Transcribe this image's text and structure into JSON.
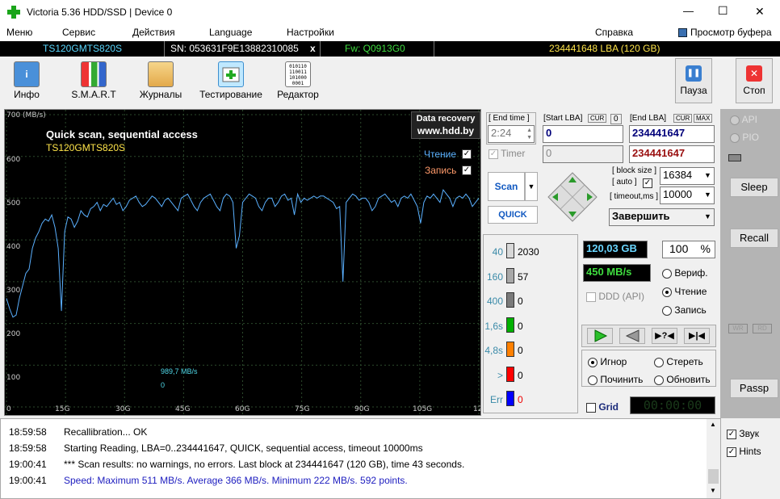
{
  "window": {
    "title": "Victoria 5.36 HDD/SSD | Device 0",
    "minimize": "—",
    "maximize": "☐",
    "close": "✕"
  },
  "menu": {
    "items": [
      "Меню",
      "Сервис",
      "Действия",
      "Language",
      "Настройки"
    ],
    "help": "Справка",
    "buffer": "Просмотр буфера"
  },
  "info": {
    "model": "TS120GMTS820S",
    "sn": "SN: 053631F9E13882310085",
    "x": "x",
    "fw": "Fw: Q0913G0",
    "lba": "234441648 LBA (120 GB)"
  },
  "toolbar": {
    "info": "Инфо",
    "smart": "S.M.A.R.T",
    "logs": "Журналы",
    "test": "Тестирование",
    "editor": "Редактор",
    "pause": "Пауза",
    "stop": "Стоп"
  },
  "graph": {
    "title": "Quick scan, sequential access",
    "model": "TS120GMTS820S",
    "recovery1": "Data recovery",
    "recovery2": "www.hdd.by",
    "read": "Чтение",
    "write": "Запись",
    "max_label": "989,7 MB/s",
    "zero": "0",
    "y_unit": "700 (MB/s)",
    "yticks": [
      "600",
      "500",
      "400",
      "300",
      "200",
      "100"
    ],
    "xticks": [
      "0",
      "15G",
      "30G",
      "45G",
      "60G",
      "75G",
      "90G",
      "105G",
      "12"
    ]
  },
  "chart_data": {
    "type": "line",
    "title": "Quick scan, sequential access",
    "xlabel": "",
    "ylabel": "MB/s",
    "ylim": [
      0,
      700
    ],
    "x_range_gb": [
      0,
      120
    ],
    "series": [
      {
        "name": "Чтение",
        "values": [
          260,
          235,
          215,
          220,
          260,
          290,
          320,
          330,
          380,
          405,
          420,
          440,
          450,
          445,
          460,
          430,
          380,
          230,
          420,
          455,
          450,
          430,
          445,
          470,
          460,
          455,
          475,
          480,
          490,
          470,
          485,
          480,
          490,
          500,
          485,
          490,
          470,
          480,
          495,
          500,
          505,
          490,
          480,
          485,
          495,
          505,
          500,
          490,
          480,
          495,
          500,
          490,
          480,
          470,
          500,
          505,
          510,
          495,
          480,
          470,
          490,
          500,
          505,
          510,
          495,
          480,
          470,
          500,
          510,
          505,
          490,
          380,
          410,
          490,
          500,
          510,
          505,
          500,
          480,
          470,
          490,
          500,
          500,
          480,
          490,
          505,
          510,
          495,
          500,
          460,
          510,
          490,
          500,
          495,
          500,
          505,
          500,
          505,
          505,
          500,
          495,
          490,
          475,
          480,
          300,
          490,
          500,
          510,
          505,
          495,
          500,
          500,
          490,
          470,
          480,
          500,
          505,
          510,
          500,
          490,
          495,
          480,
          500,
          505,
          500,
          510,
          495,
          480,
          440,
          490,
          505,
          500,
          510,
          500,
          490,
          520,
          510,
          500,
          480,
          500,
          505,
          500,
          510,
          500,
          480,
          490,
          500
        ]
      }
    ]
  },
  "test": {
    "end_time_label": "[ End time ]",
    "start_lba_label": "[Start LBA]",
    "cur": "CUR",
    "cur_val": "0",
    "end_lba_label": "[End LBA]",
    "max": "MAX",
    "time": "2:24",
    "start_lba": "0",
    "end_lba": "234441647",
    "timer_label": "Timer",
    "timer_val": "0",
    "end_lba2": "234441647",
    "scan": "Scan",
    "quick": "QUICK",
    "block_size_label": "[ block size ]",
    "auto_label": "[ auto ]",
    "timeout_label": "[ timeout,ms ]",
    "block_size": "16384",
    "timeout": "10000",
    "finish": "Завершить"
  },
  "stats": {
    "rows": [
      {
        "label": "40",
        "count": "2030",
        "color": "#d8d8d8"
      },
      {
        "label": "160",
        "count": "57",
        "color": "#a8a8a8"
      },
      {
        "label": "400",
        "count": "0",
        "color": "#7a7a7a"
      },
      {
        "label": "1,6s",
        "count": "0",
        "color": "#00b000"
      },
      {
        "label": "4,8s",
        "count": "0",
        "color": "#ff8000"
      },
      {
        "label": ">",
        "count": "0",
        "color": "#ff0000"
      },
      {
        "label": "Err",
        "count": "0",
        "color": "#0000ff"
      }
    ]
  },
  "metrics": {
    "gb": "120,03 GB",
    "percent": "100",
    "pct_sign": "%",
    "speed": "450 MB/s",
    "verify": "Вериф.",
    "read": "Чтение",
    "write": "Запись",
    "ddd": "DDD (API)",
    "ignore": "Игнор",
    "erase": "Стереть",
    "repair": "Починить",
    "refresh": "Обновить",
    "grid": "Grid",
    "clock": "00:00:00"
  },
  "side": {
    "api": "API",
    "pio": "PIO",
    "sleep": "Sleep",
    "recall": "Recall",
    "wr": "WR",
    "rd": "RD",
    "passp": "Passp",
    "sound": "Звук",
    "hints": "Hints"
  },
  "log": [
    {
      "time": "18:59:58",
      "text": "Recallibration... OK",
      "color": "#000"
    },
    {
      "time": "18:59:58",
      "text": "Starting Reading, LBA=0..234441647, QUICK, sequential access, timeout 10000ms",
      "color": "#000"
    },
    {
      "time": "19:00:41",
      "text": "*** Scan results: no warnings, no errors. Last block at 234441647 (120 GB), time 43 seconds.",
      "color": "#000"
    },
    {
      "time": "19:00:41",
      "text": "Speed: Maximum 511 MB/s. Average 366 MB/s. Minimum 222 MB/s. 592 points.",
      "color": "#2020c0"
    }
  ]
}
